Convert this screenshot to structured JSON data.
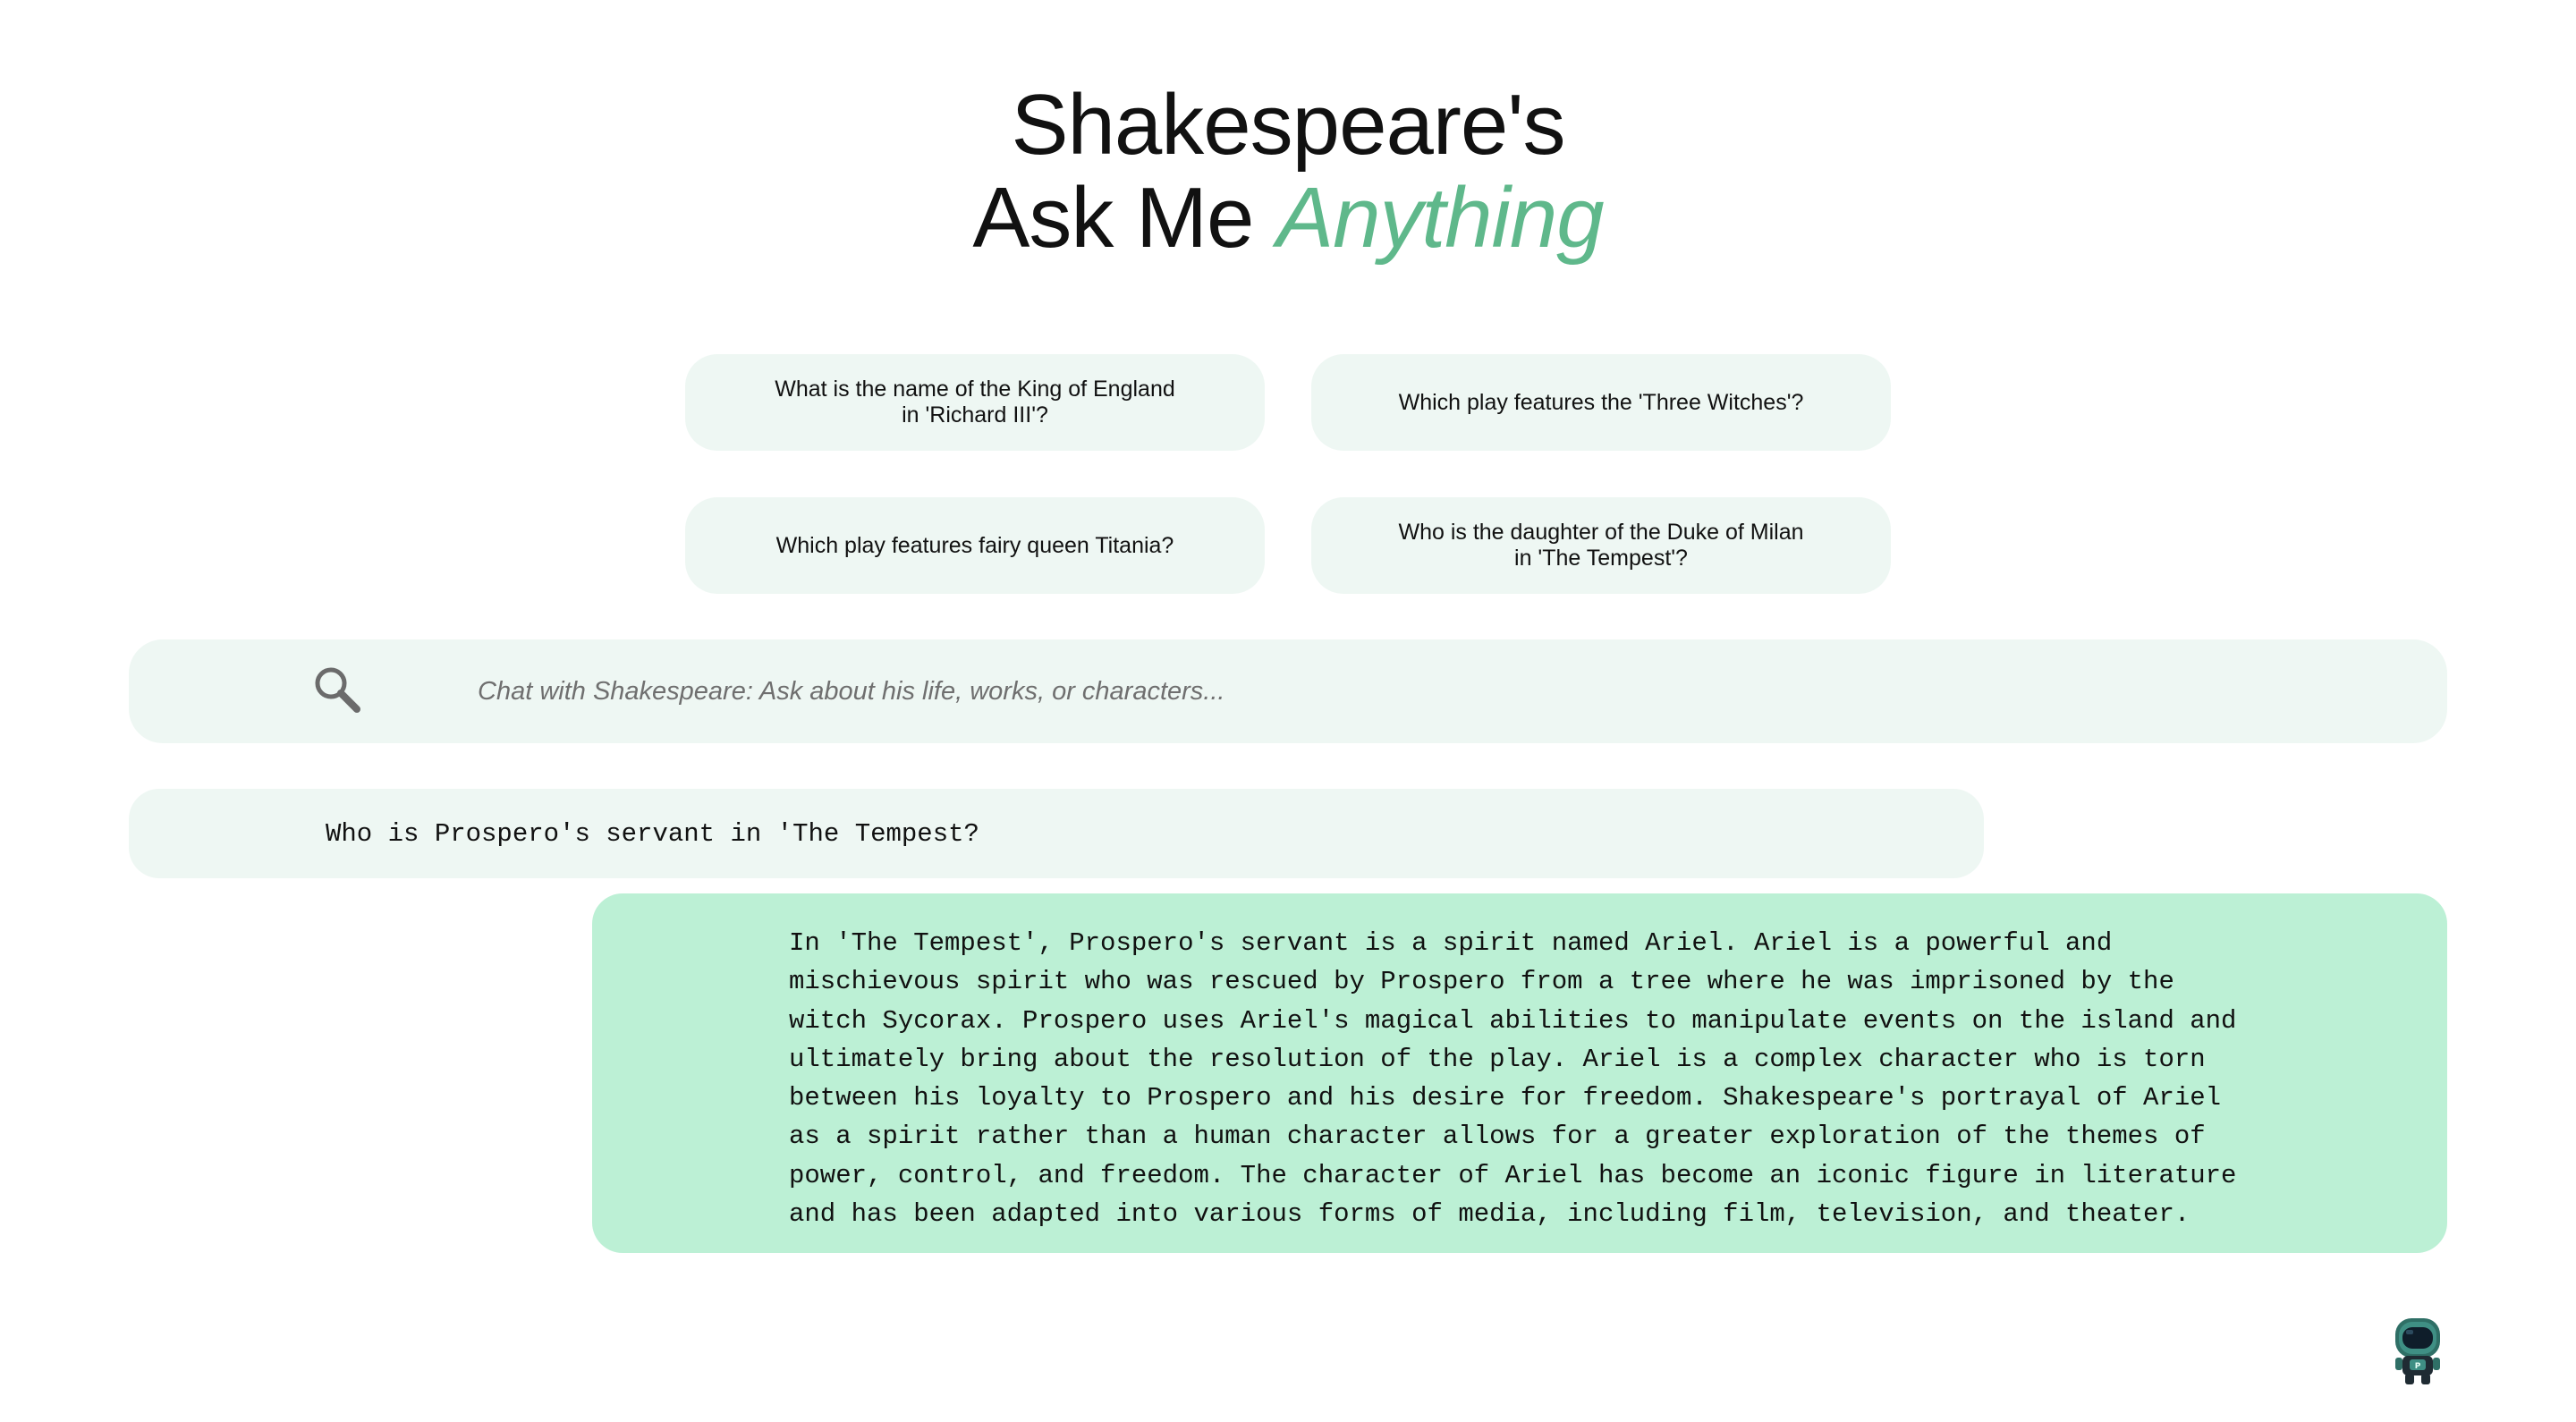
{
  "header": {
    "title_line1": "Shakespeare's",
    "title_line2_prefix": "Ask Me",
    "title_line2_accent": "Anything"
  },
  "suggestions": [
    {
      "label": "What is the name of the King of England in 'Richard III'?"
    },
    {
      "label": "Which play features the 'Three Witches'?"
    },
    {
      "label": "Which play features fairy queen Titania?"
    },
    {
      "label": "Who is the daughter of the Duke of Milan in 'The Tempest'?"
    }
  ],
  "search": {
    "placeholder": "Chat with Shakespeare: Ask about his life, works, or characters...",
    "icon": "search-icon"
  },
  "conversation": {
    "user_message": "Who is Prospero's servant in 'The Tempest?",
    "assistant_lines": [
      "In 'The Tempest', Prospero's servant is a spirit named Ariel. Ariel is a powerful and",
      "mischievous spirit who was rescued by Prospero from a tree where he was imprisoned by the",
      "witch Sycorax. Prospero uses Ariel's magical abilities to manipulate events on the island and",
      "ultimately bring about the resolution of the play. Ariel is a complex character who is torn",
      "between his loyalty to Prospero and his desire for freedom. Shakespeare's portrayal of Ariel",
      "as a spirit rather than a human character allows for a greater exploration of the themes of",
      "power, control, and freedom. The character of Ariel has become an iconic figure in literature",
      "and has been adapted into various forms of media, including film, television, and theater."
    ]
  },
  "avatar": {
    "icon": "astronaut-avatar-icon"
  },
  "colors": {
    "accent": "#5fb88b",
    "panel": "#eef7f3",
    "assistant_bubble": "#bcf0d5",
    "text": "#111111"
  }
}
